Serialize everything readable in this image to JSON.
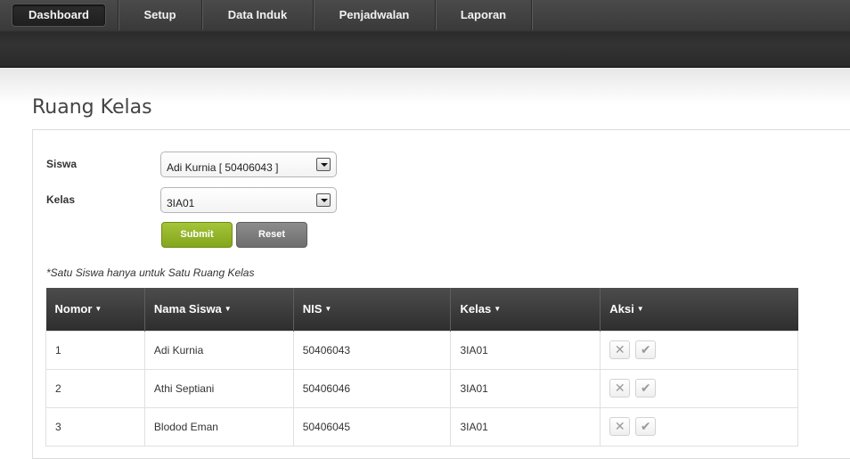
{
  "nav": {
    "items": [
      {
        "label": "Dashboard",
        "active": true
      },
      {
        "label": "Setup"
      },
      {
        "label": "Data Induk"
      },
      {
        "label": "Penjadwalan"
      },
      {
        "label": "Laporan"
      }
    ]
  },
  "page": {
    "title": "Ruang Kelas"
  },
  "form": {
    "siswa_label": "Siswa",
    "siswa_value": "Adi Kurnia [ 50406043 ]",
    "kelas_label": "Kelas",
    "kelas_value": "3IA01",
    "submit_label": "Submit",
    "reset_label": "Reset",
    "note": "*Satu Siswa hanya untuk Satu Ruang Kelas"
  },
  "table": {
    "columns": [
      "Nomor",
      "Nama Siswa",
      "NIS",
      "Kelas",
      "Aksi"
    ],
    "sort_glyph": "▼",
    "rows": [
      {
        "no": "1",
        "nama": "Adi Kurnia",
        "nis": "50406043",
        "kelas": "3IA01"
      },
      {
        "no": "2",
        "nama": "Athi Septiani",
        "nis": "50406046",
        "kelas": "3IA01"
      },
      {
        "no": "3",
        "nama": "Blodod Eman",
        "nis": "50406045",
        "kelas": "3IA01"
      }
    ],
    "action_icons": {
      "delete": "✕",
      "confirm": "✔"
    }
  }
}
